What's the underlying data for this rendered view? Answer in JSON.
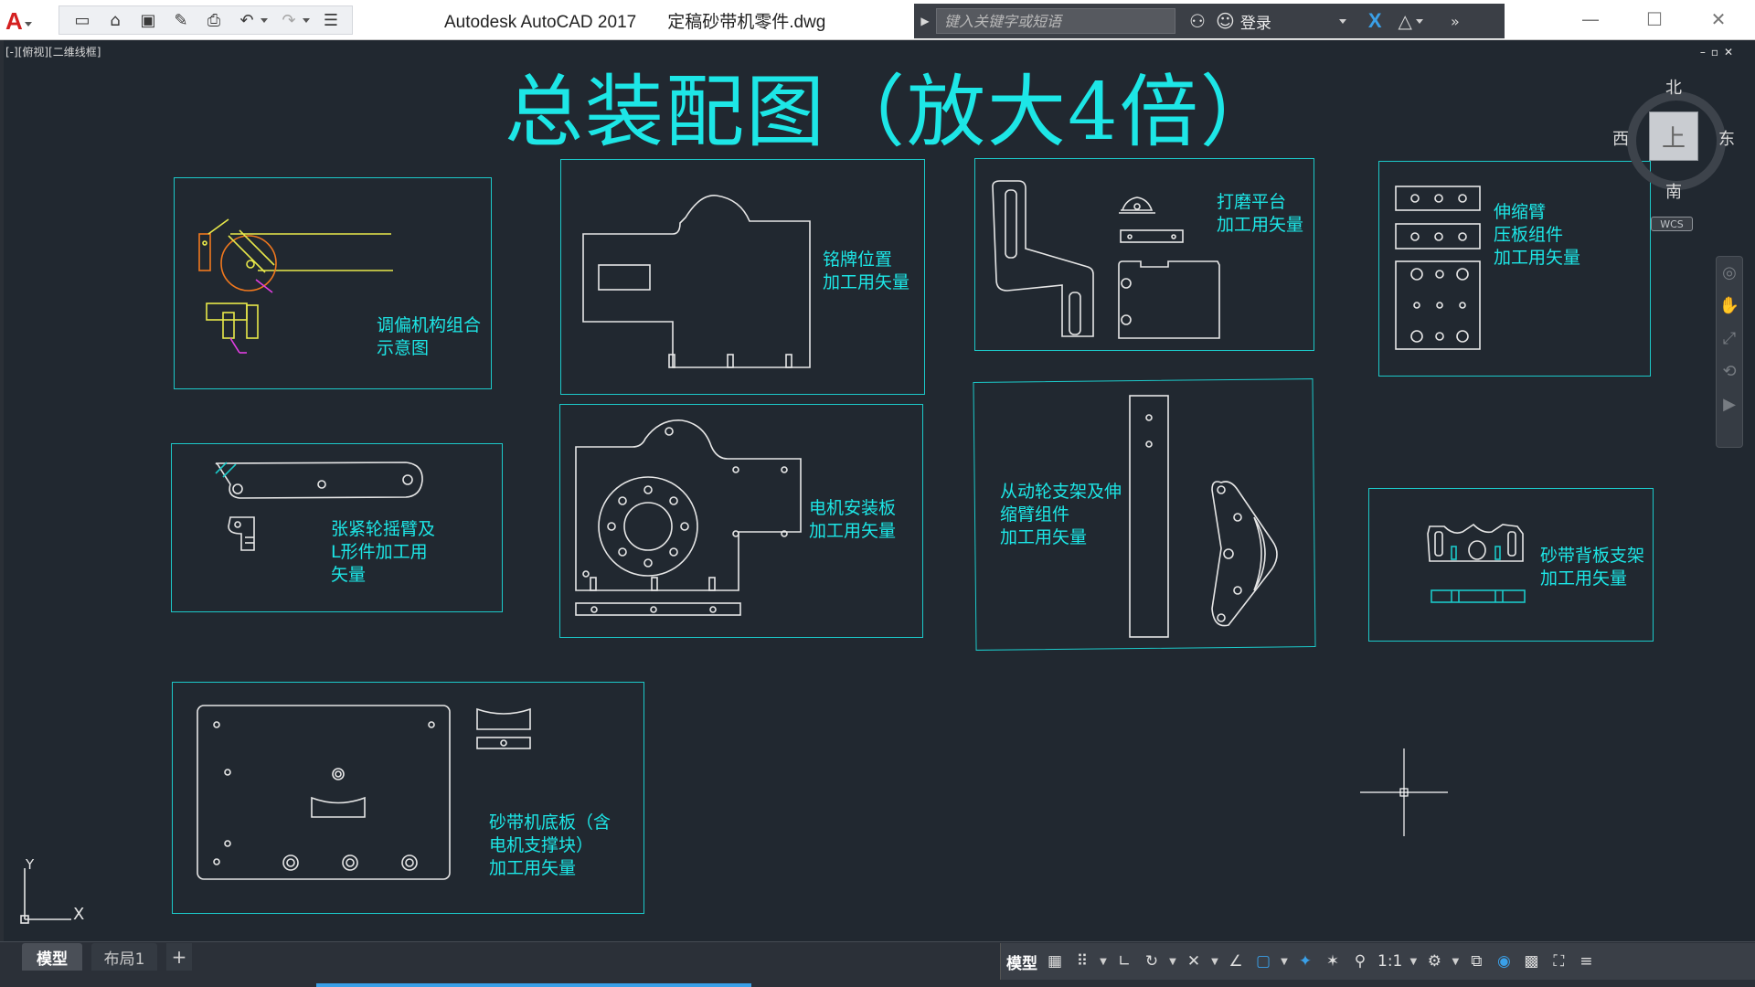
{
  "title_bar": {
    "app_name": "Autodesk AutoCAD 2017",
    "file_name": "定稿砂带机零件.dwg",
    "search_placeholder": "键入关键字或短语",
    "login_label": "登录"
  },
  "viewport": {
    "label": "[-][俯视][二维线框]",
    "drawing_title": "总装配图（放大4倍）",
    "viewcube": {
      "top": "上",
      "north": "北",
      "south": "南",
      "east": "东",
      "west": "西",
      "wcs": "WCS"
    }
  },
  "panels": {
    "p1": {
      "lines": [
        "调偏机构组合",
        "示意图"
      ]
    },
    "p2": {
      "lines": [
        "铭牌位置",
        "加工用矢量"
      ]
    },
    "p3": {
      "lines": [
        "打磨平台",
        "加工用矢量"
      ]
    },
    "p4": {
      "lines": [
        "伸缩臂",
        "压板组件",
        "加工用矢量"
      ]
    },
    "p5": {
      "lines": [
        "张紧轮摇臂及",
        "L形件加工用",
        "矢量"
      ]
    },
    "p6": {
      "lines": [
        "电机安装板",
        "加工用矢量"
      ]
    },
    "p7": {
      "lines": [
        "从动轮支架及伸",
        "缩臂组件",
        "加工用矢量"
      ]
    },
    "p8": {
      "lines": [
        "砂带背板支架",
        "加工用矢量"
      ]
    },
    "p9": {
      "lines": [
        "砂带机底板（含",
        "电机支撑块）",
        "加工用矢量"
      ]
    }
  },
  "ucs": {
    "x": "X",
    "y": "Y"
  },
  "layout_tabs": {
    "model": "模型",
    "layout1": "布局1",
    "add": "+"
  },
  "status_bar": {
    "model": "模型",
    "scale": "1:1"
  },
  "colors": {
    "accent": "#1de6e6",
    "frame": "#1cc9c9",
    "background": "#212830",
    "geometry": "#e6e6e6",
    "yellow": "#e8e84a",
    "magenta": "#e23ee2",
    "orange": "#f0781e"
  }
}
